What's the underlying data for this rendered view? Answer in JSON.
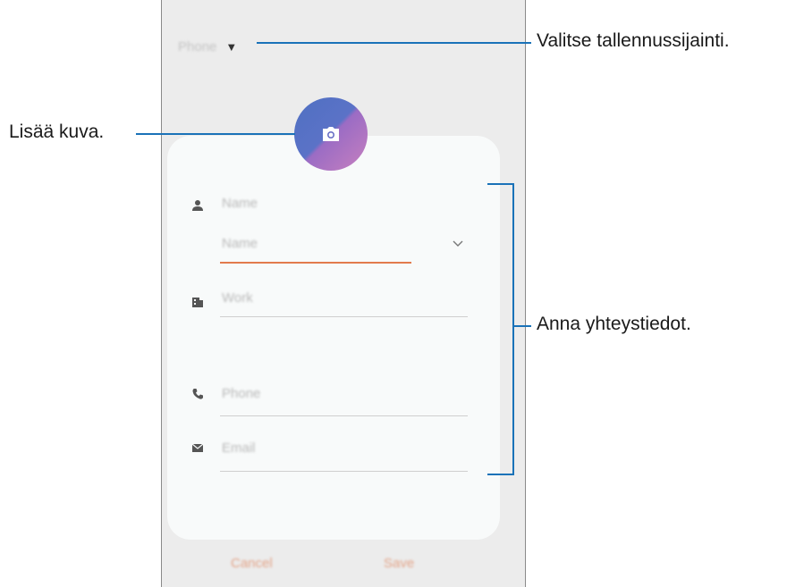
{
  "header": {
    "storage_label": "Phone",
    "storage_caret": "▼"
  },
  "photo": {
    "icon": "camera-icon"
  },
  "form": {
    "name_label": "Name",
    "name_field": "Name",
    "work_field": "Work",
    "phone_field": "Phone",
    "email_field": "Email"
  },
  "footer": {
    "cancel_label": "Cancel",
    "save_label": "Save"
  },
  "callouts": {
    "storage": "Valitse tallennussijainti.",
    "photo": "Lisää kuva.",
    "details": "Anna yhteystiedot."
  },
  "colors": {
    "accent_underline": "#e27a4d",
    "callout_line": "#1a72b8"
  }
}
